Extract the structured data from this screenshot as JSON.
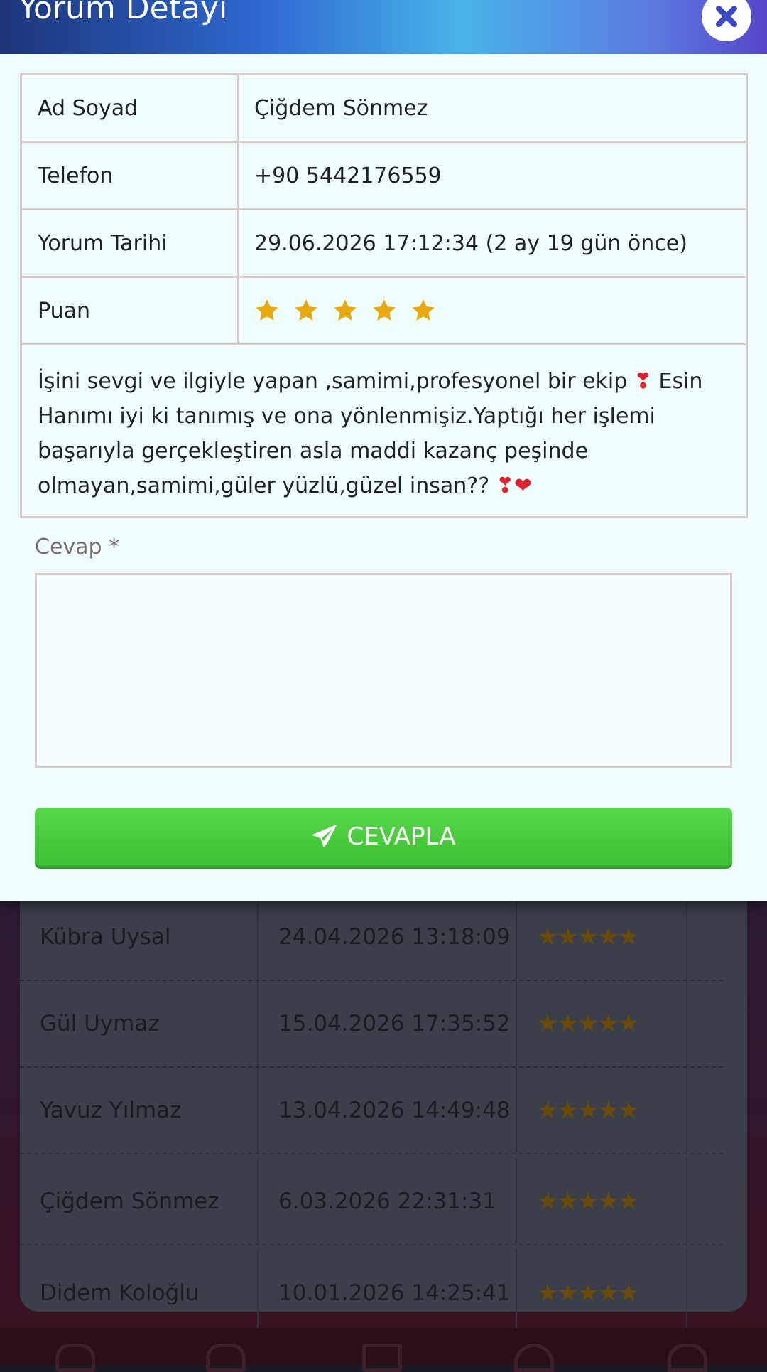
{
  "modal": {
    "title": "Yorum Detayı",
    "rows": [
      {
        "label": "Ad Soyad",
        "value": "Çiğdem Sönmez"
      },
      {
        "label": "Telefon",
        "value": "+90 5442176559"
      },
      {
        "label": "Yorum Tarihi",
        "value": "29.06.2026 17:12:34 (2 ay 19 gün önce)"
      },
      {
        "label": "Puan",
        "rating": 5,
        "max_rating": 5
      }
    ],
    "comment": {
      "part1": "İşini sevgi ve ilgiyle yapan ,samimi,profesyonel bir ekip ",
      "emoji1": "❣",
      "part2": " Esin Hanımı iyi ki tanımış ve ona yönlenmişiz.Yaptığı her işlemi başarıyla gerçekleştiren asla maddi kazanç peşinde olmayan,samimi,güler yüzlü,güzel insan?? ",
      "emoji2": "❣",
      "emoji3": "❤"
    },
    "answer": {
      "label": "Cevap",
      "required_mark": "*",
      "value": ""
    },
    "reply_button": {
      "label": "CEVAPLA",
      "icon": "paper-plane-icon"
    },
    "close_icon": "close-icon"
  },
  "background_list": {
    "rows": [
      {
        "name": "Kübra Uysal",
        "date": "24.04.2026 13:18:09",
        "rating": 5
      },
      {
        "name": "Gül Uymaz",
        "date": "15.04.2026 17:35:52",
        "rating": 5
      },
      {
        "name": "Yavuz Yılmaz",
        "date": "13.04.2026 14:49:48",
        "rating": 5
      },
      {
        "name": "Çiğdem Sönmez",
        "date": "6.03.2026 22:31:31",
        "rating": 5
      },
      {
        "name": "Didem Koloğlu",
        "date": "10.01.2026 14:25:41",
        "rating": 5
      }
    ]
  },
  "colors": {
    "accent_green": "#3fbf33",
    "star_gold": "#e8a911",
    "modal_bg": "#effdfc",
    "header_blue": "#2f6ad2"
  }
}
